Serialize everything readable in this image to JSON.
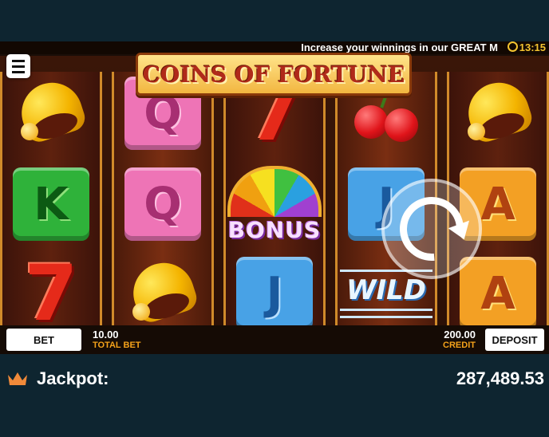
{
  "header": {
    "ticker_text": "Increase your winnings in our GREAT M",
    "clock_time": "13:15"
  },
  "game": {
    "logo_text": "COINS OF FORTUNE",
    "reels": [
      [
        "bell",
        "K",
        "7"
      ],
      [
        "Q",
        "Q",
        "bell"
      ],
      [
        "7",
        "bonus",
        "J"
      ],
      [
        "cherry",
        "J",
        "wild"
      ],
      [
        "bell",
        "A",
        "A"
      ]
    ],
    "bonus_label": "BONUS",
    "wild_label": "WILD",
    "symbol_K": "K",
    "symbol_Q": "Q",
    "symbol_J": "J",
    "symbol_A": "A",
    "symbol_7": "7"
  },
  "controls": {
    "bet_label": "BET",
    "total_bet_value": "10.00",
    "total_bet_label": "TOTAL BET",
    "credit_value": "200.00",
    "credit_label": "CREDIT",
    "deposit_label": "DEPOSIT"
  },
  "jackpot": {
    "label": "Jackpot:",
    "value": "287,489.53"
  },
  "colors": {
    "page_bg": "#0e2530",
    "accent": "#f4a21a",
    "crown": "#f08a3a"
  }
}
